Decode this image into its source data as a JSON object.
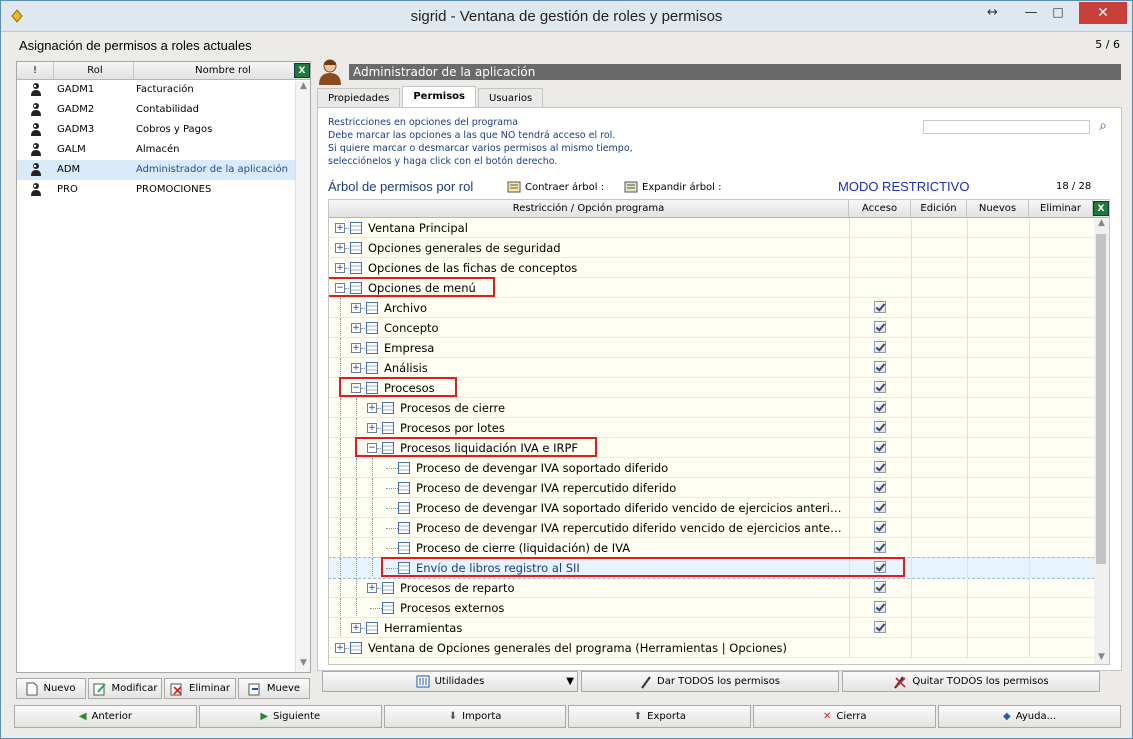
{
  "window": {
    "title": "sigrid - Ventana de gestión de roles y permisos",
    "resize_glyph": "↔",
    "minimize_glyph": "—",
    "maximize_glyph": "□",
    "close_glyph": "✕"
  },
  "header": {
    "title": "Asignación de permisos a roles actuales",
    "pager": "5 / 6"
  },
  "roles": {
    "columns": [
      "!",
      "Rol",
      "Nombre rol"
    ],
    "excel_label": "X",
    "rows": [
      {
        "code": "GADM1",
        "name": "Facturación"
      },
      {
        "code": "GADM2",
        "name": "Contabilidad"
      },
      {
        "code": "GADM3",
        "name": "Cobros y Pagos"
      },
      {
        "code": "GALM",
        "name": "Almacén"
      },
      {
        "code": "ADM",
        "name": "Administrador de la aplicación"
      },
      {
        "code": "PRO",
        "name": "PROMOCIONES"
      }
    ],
    "buttons": {
      "new": "Nuevo",
      "modify": "Modificar",
      "delete": "Eliminar",
      "move": "Mueve"
    }
  },
  "detail": {
    "title": "Administrador de la aplicación",
    "tabs": [
      "Propiedades",
      "Permisos",
      "Usuarios"
    ],
    "info_lines": [
      "Restricciones en opciones del programa",
      "Debe marcar las opciones a las que NO tendrá acceso el rol.",
      "Si quiere marcar o desmarcar varios permisos al mismo tiempo,",
      "selecciónelos y haga click con el botón derecho."
    ],
    "tree_heading": "Árbol de permisos por rol",
    "collapse_label": "Contraer árbol :",
    "expand_label": "Expandir árbol :",
    "mode": "MODO RESTRICTIVO",
    "count": "18 / 28",
    "columns": [
      "Restricción / Opción programa",
      "Acceso",
      "Edición",
      "Nuevos",
      "Eliminar"
    ],
    "rows": [
      {
        "label": "Ventana Principal",
        "level": 0,
        "exp": "+",
        "checked": false
      },
      {
        "label": "Opciones generales de seguridad",
        "level": 0,
        "exp": "+",
        "checked": false
      },
      {
        "label": "Opciones de las fichas de conceptos",
        "level": 0,
        "exp": "+",
        "checked": false
      },
      {
        "label": "Opciones de menú",
        "level": 0,
        "exp": "−",
        "checked": false
      },
      {
        "label": "Archivo",
        "level": 1,
        "exp": "+",
        "checked": true
      },
      {
        "label": "Concepto",
        "level": 1,
        "exp": "+",
        "checked": true
      },
      {
        "label": "Empresa",
        "level": 1,
        "exp": "+",
        "checked": true
      },
      {
        "label": "Análisis",
        "level": 1,
        "exp": "+",
        "checked": true
      },
      {
        "label": "Procesos",
        "level": 1,
        "exp": "−",
        "checked": true
      },
      {
        "label": "Procesos de cierre",
        "level": 2,
        "exp": "+",
        "checked": true
      },
      {
        "label": "Procesos por lotes",
        "level": 2,
        "exp": "+",
        "checked": true
      },
      {
        "label": "Procesos liquidación IVA e IRPF",
        "level": 2,
        "exp": "−",
        "checked": true
      },
      {
        "label": "Proceso de devengar IVA soportado diferido",
        "level": 3,
        "exp": "",
        "checked": true
      },
      {
        "label": "Proceso de devengar IVA repercutido diferido",
        "level": 3,
        "exp": "",
        "checked": true
      },
      {
        "label": "Proceso de devengar IVA soportado diferido vencido de ejercicios anteri…",
        "level": 3,
        "exp": "",
        "checked": true
      },
      {
        "label": "Proceso de devengar IVA repercutido diferido vencido de ejercicios ante…",
        "level": 3,
        "exp": "",
        "checked": true
      },
      {
        "label": "Proceso de cierre (liquidación) de IVA",
        "level": 3,
        "exp": "",
        "checked": true
      },
      {
        "label": "Envío de libros registro al SII",
        "level": 3,
        "exp": "",
        "checked": true
      },
      {
        "label": "Procesos de reparto",
        "level": 2,
        "exp": "+",
        "checked": true
      },
      {
        "label": "Procesos externos",
        "level": 2,
        "exp": "",
        "checked": true
      },
      {
        "label": "Herramientas",
        "level": 1,
        "exp": "+",
        "checked": true
      },
      {
        "label": "Ventana de Opciones generales del programa (Herramientas | Opciones)",
        "level": 0,
        "exp": "+",
        "checked": false
      }
    ],
    "buttons": {
      "utilities": "Utilidades",
      "grant_all": "Dar TODOS los permisos",
      "remove_all": "Quitar TODOS los permisos"
    }
  },
  "bottom": {
    "prev": "Anterior",
    "next": "Siguiente",
    "import": "Importa",
    "export": "Exporta",
    "close": "Cierra",
    "help": "Ayuda..."
  },
  "colors": {
    "accent_blue": "#1a3c80",
    "mode_blue": "#1e2bb8",
    "highlight_red": "#e21c1c",
    "title_grey": "#6a6a6a"
  }
}
